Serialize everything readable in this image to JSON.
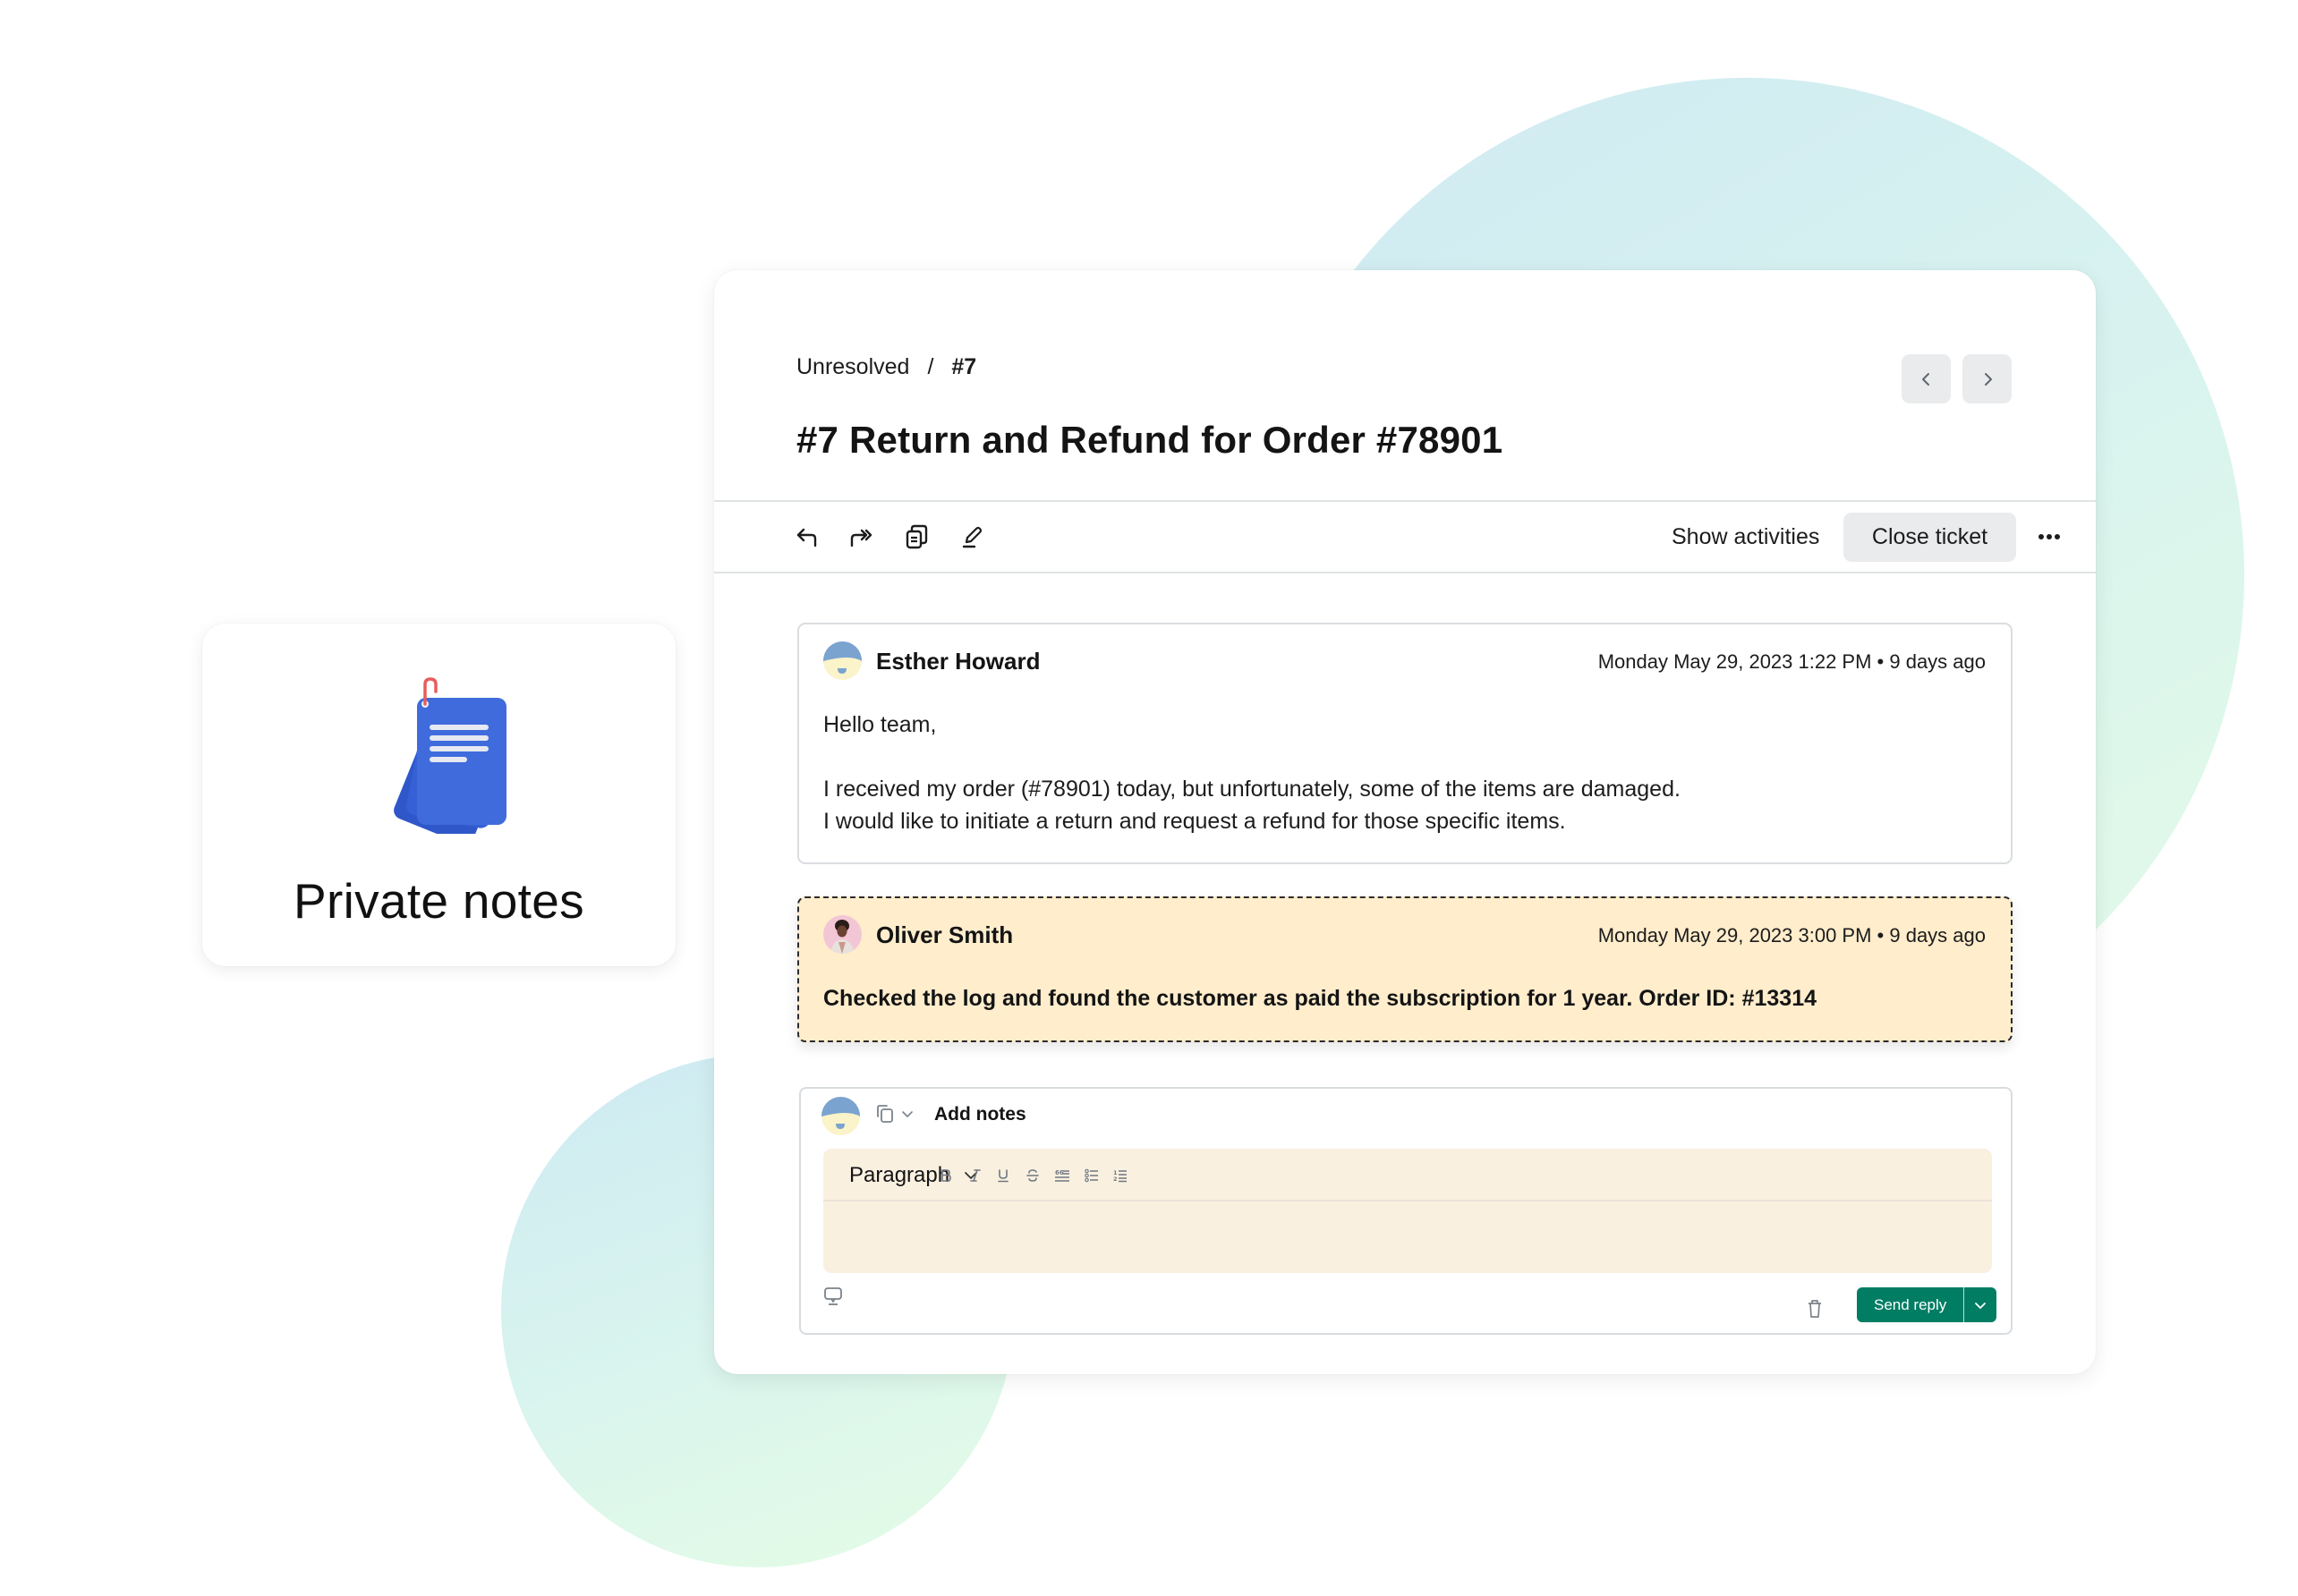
{
  "feature_card": {
    "title": "Private notes",
    "icon": "notes-stack-icon",
    "colors": {
      "notes_blue": "#3f6bdc",
      "clip_red": "#e85c5c"
    }
  },
  "ticket": {
    "breadcrumb": {
      "status": "Unresolved",
      "separator": "/",
      "current": "#7"
    },
    "title": "#7 Return and Refund for Order #78901",
    "nav": {
      "prev_icon": "chevron-left-icon",
      "next_icon": "chevron-right-icon"
    },
    "actions": {
      "icons": [
        "reply-icon",
        "forward-icon",
        "copy-icon",
        "edit-icon"
      ],
      "show_activities": "Show activities",
      "close_ticket": "Close ticket",
      "more_icon": "more-horizontal-icon"
    }
  },
  "messages": [
    {
      "type": "customer",
      "author": "Esther Howard",
      "timestamp": "Monday May 29, 2023 1:22 PM • 9 days ago",
      "body": [
        "Hello team,",
        "",
        "I received my order (#78901) today, but unfortunately, some of the items are damaged.",
        "I would like to initiate a return and request a refund for those specific items."
      ]
    },
    {
      "type": "private-note",
      "author": "Oliver Smith",
      "timestamp": "Monday May 29, 2023 3:00 PM • 9 days ago",
      "body": [
        "Checked the log and found the customer as paid the subscription for 1 year. Order ID: #13314"
      ]
    }
  ],
  "composer": {
    "mode_label": "Add notes",
    "block_style": "Paragraph",
    "format_buttons": [
      "bold",
      "italic",
      "underline",
      "strikethrough",
      "blockquote",
      "bullet-list",
      "numbered-list"
    ],
    "editor_value": "",
    "send_label": "Send reply"
  },
  "colors": {
    "accent_green": "#007d63",
    "note_background": "#ffedcc",
    "editor_background": "#faf0e0",
    "button_gray": "#eaebed"
  }
}
